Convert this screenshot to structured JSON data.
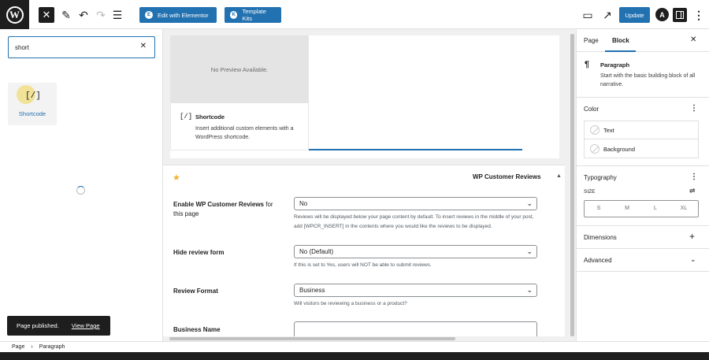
{
  "toolbar": {
    "logo_glyph": "W",
    "close_glyph": "✕",
    "pen_glyph": "✎",
    "undo_glyph": "↶",
    "redo_glyph": "↷",
    "overview_glyph": "☰",
    "edit_elementor_label": "Edit with Elementor",
    "elementor_badge": "E",
    "template_kits_label": "Template Kits",
    "template_kits_badge": "K",
    "desktop_glyph": "▭",
    "view_glyph": "↗",
    "update_label": "Update",
    "astra_glyph": "A",
    "more_glyph": "⋮"
  },
  "inserter": {
    "search_value": "short",
    "clear_glyph": "✕",
    "results": [
      {
        "label": "Shortcode",
        "glyph": "[/]"
      }
    ]
  },
  "snackbar": {
    "message": "Page published.",
    "action": "View Page"
  },
  "preview": {
    "no_preview": "No Preview Available.",
    "icon": "[/]",
    "title": "Shortcode",
    "description": "Insert additional custom elements with a WordPress shortcode."
  },
  "metabox": {
    "star_glyph": "★",
    "title": "WP Customer Reviews",
    "toggle_glyph": "▲",
    "fields": {
      "enable": {
        "label_bold": "Enable WP Customer Reviews",
        "label_plain": " for this page",
        "value": "No",
        "help": "Reviews will be displayed below your page content by default. To insert reviews in the middle of your post, add [WPCR_INSERT] in the contents where you would like the reviews to be displayed."
      },
      "hide_form": {
        "label": "Hide review form",
        "value": "No (Default)",
        "help": "If this is set to Yes, users will NOT be able to submit reviews."
      },
      "format": {
        "label": "Review Format",
        "value": "Business",
        "help": "Will visitors be reviewing a business or a product?"
      },
      "business_name": {
        "label": "Business Name",
        "value": ""
      }
    },
    "caret_glyph": "⌄"
  },
  "sidebar": {
    "tabs": [
      {
        "label": "Page"
      },
      {
        "label": "Block"
      }
    ],
    "close_glyph": "✕",
    "block_card": {
      "icon": "¶",
      "title": "Paragraph",
      "description": "Start with the basic building block of all narrative."
    },
    "color": {
      "title": "Color",
      "items": [
        {
          "label": "Text"
        },
        {
          "label": "Background"
        }
      ]
    },
    "typography": {
      "title": "Typography",
      "size_label": "SIZE",
      "size_settings_glyph": "⇌",
      "sizes": [
        "S",
        "M",
        "L",
        "XL"
      ]
    },
    "dimensions": {
      "title": "Dimensions",
      "add_glyph": "+"
    },
    "advanced": {
      "title": "Advanced",
      "chevron_glyph": "⌄"
    },
    "kebab_glyph": "⋮"
  },
  "breadcrumb": {
    "items": [
      "Page",
      "Paragraph"
    ],
    "separator": "›"
  },
  "colors": {
    "accent": "#2271b1",
    "dark": "#1e1e1e",
    "canvas_bg": "#f0f0f0"
  }
}
